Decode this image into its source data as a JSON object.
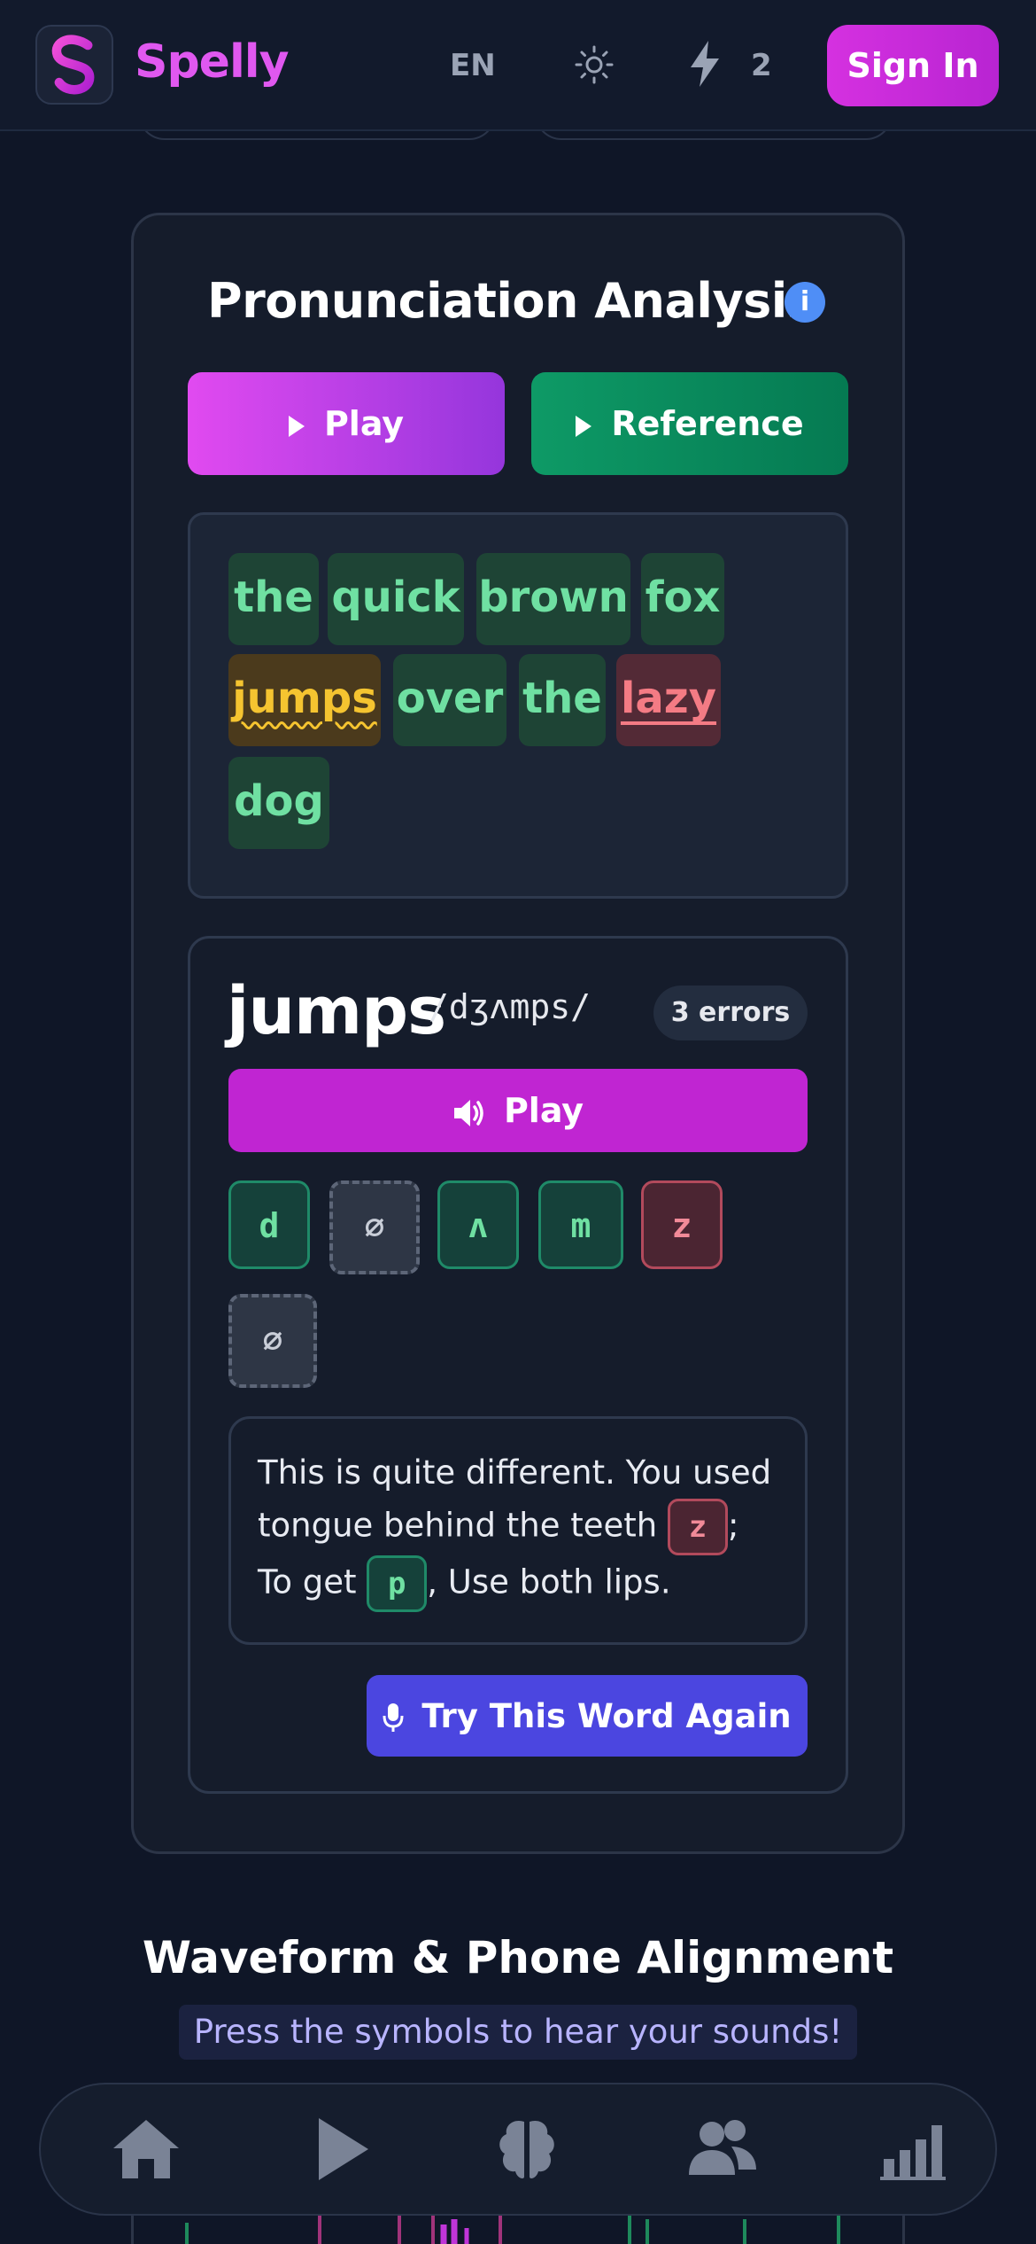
{
  "header": {
    "brand": "Spelly",
    "language": "EN",
    "bolt_count": "2",
    "sign_in_label": "Sign In",
    "icons": [
      "spelly-logo-icon",
      "sun-icon",
      "bolt-icon"
    ]
  },
  "analysis": {
    "title": "Pronunciation Analysis",
    "info_glyph": "i",
    "play_label": "Play",
    "reference_label": "Reference",
    "words": [
      {
        "text": "the",
        "status": "correct"
      },
      {
        "text": "quick",
        "status": "correct"
      },
      {
        "text": "brown",
        "status": "correct"
      },
      {
        "text": "fox",
        "status": "correct"
      },
      {
        "text": "jumps",
        "status": "warning"
      },
      {
        "text": "over",
        "status": "correct"
      },
      {
        "text": "the",
        "status": "correct"
      },
      {
        "text": "lazy",
        "status": "error"
      },
      {
        "text": "dog",
        "status": "correct"
      }
    ]
  },
  "detail": {
    "word": "jumps",
    "ipa": "/dʒʌmps/",
    "errors_label": "3 errors",
    "play_label": "Play",
    "phones": [
      {
        "symbol": "d",
        "status": "correct"
      },
      {
        "symbol": "∅",
        "status": "missing"
      },
      {
        "symbol": "ʌ",
        "status": "correct"
      },
      {
        "symbol": "m",
        "status": "correct"
      },
      {
        "symbol": "z",
        "status": "wrong"
      },
      {
        "symbol": "∅",
        "status": "missing"
      }
    ],
    "feedback": {
      "part1": "This is quite different. You used tongue behind the teeth",
      "phone_used": "z",
      "part2": ";",
      "part3": "To get",
      "phone_target": "p",
      "part4": ", Use both lips."
    },
    "try_again_label": "Try This Word Again"
  },
  "waveform": {
    "title": "Waveform & Phone Alignment",
    "subtitle": "Press the symbols to hear your sounds!"
  },
  "nav": {
    "items": [
      "home-icon",
      "play-icon",
      "brain-icon",
      "users-icon",
      "chart-icon"
    ]
  },
  "colors": {
    "background": "#0f1627",
    "brand": "#e058f0",
    "correct": "#6fe0a2",
    "warning": "#f5c430",
    "error": "#f47b84",
    "accent_purple": "#c025d2",
    "accent_indigo": "#4b46e0",
    "accent_green": "#0e9a66"
  }
}
